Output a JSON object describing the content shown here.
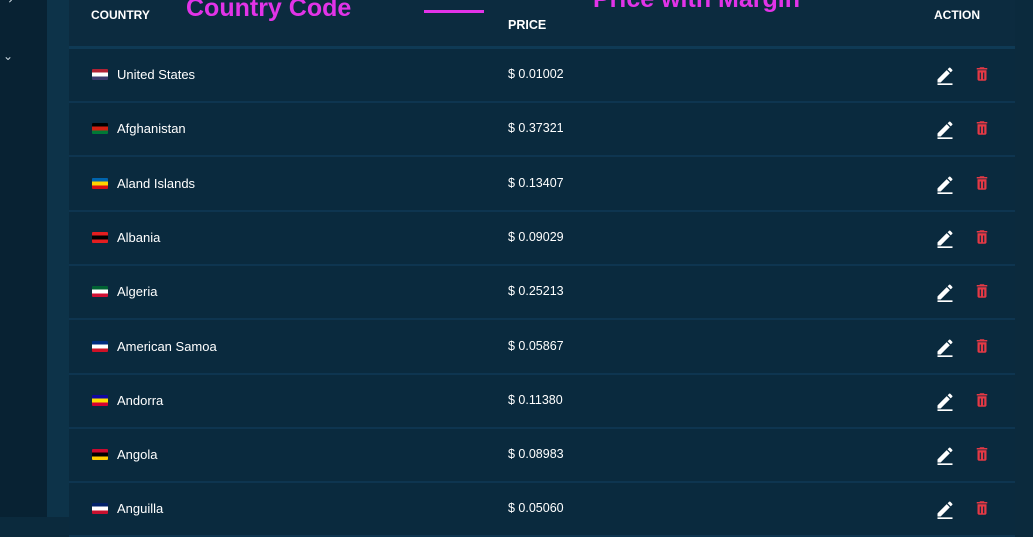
{
  "header": {
    "country_label": "COUNTRY",
    "price_label": "PRICE",
    "action_label": "ACTION"
  },
  "annotations": {
    "country_code": "Country Code",
    "price_with_margin": "Price with Margin"
  },
  "sidebar": {
    "icons": [
      "chevron-right-icon",
      "chevron-down-icon"
    ]
  },
  "rows": [
    {
      "country": "United States",
      "price": "$ 0.01002",
      "flag_colors": [
        "#b22234",
        "#ffffff",
        "#3c3b6e"
      ]
    },
    {
      "country": "Afghanistan",
      "price": "$ 0.37321",
      "flag_colors": [
        "#000000",
        "#d32011",
        "#007a36"
      ]
    },
    {
      "country": "Aland Islands",
      "price": "$ 0.13407",
      "flag_colors": [
        "#0064ad",
        "#ffd300",
        "#da0e15"
      ]
    },
    {
      "country": "Albania",
      "price": "$ 0.09029",
      "flag_colors": [
        "#e41e20",
        "#000000",
        "#e41e20"
      ]
    },
    {
      "country": "Algeria",
      "price": "$ 0.25213",
      "flag_colors": [
        "#006233",
        "#ffffff",
        "#d21034"
      ]
    },
    {
      "country": "American Samoa",
      "price": "$ 0.05867",
      "flag_colors": [
        "#002b7f",
        "#ffffff",
        "#ce1126"
      ]
    },
    {
      "country": "Andorra",
      "price": "$ 0.11380",
      "flag_colors": [
        "#10069f",
        "#fedf00",
        "#d50032"
      ]
    },
    {
      "country": "Angola",
      "price": "$ 0.08983",
      "flag_colors": [
        "#cc092f",
        "#000000",
        "#ffcb00"
      ]
    },
    {
      "country": "Anguilla",
      "price": "$ 0.05060",
      "flag_colors": [
        "#012169",
        "#ffffff",
        "#c8102e"
      ]
    }
  ],
  "colors": {
    "background": "#0b2a3d",
    "row_background": "#0a2a3e",
    "delete": "#e53945",
    "annotation": "#e233e8"
  }
}
